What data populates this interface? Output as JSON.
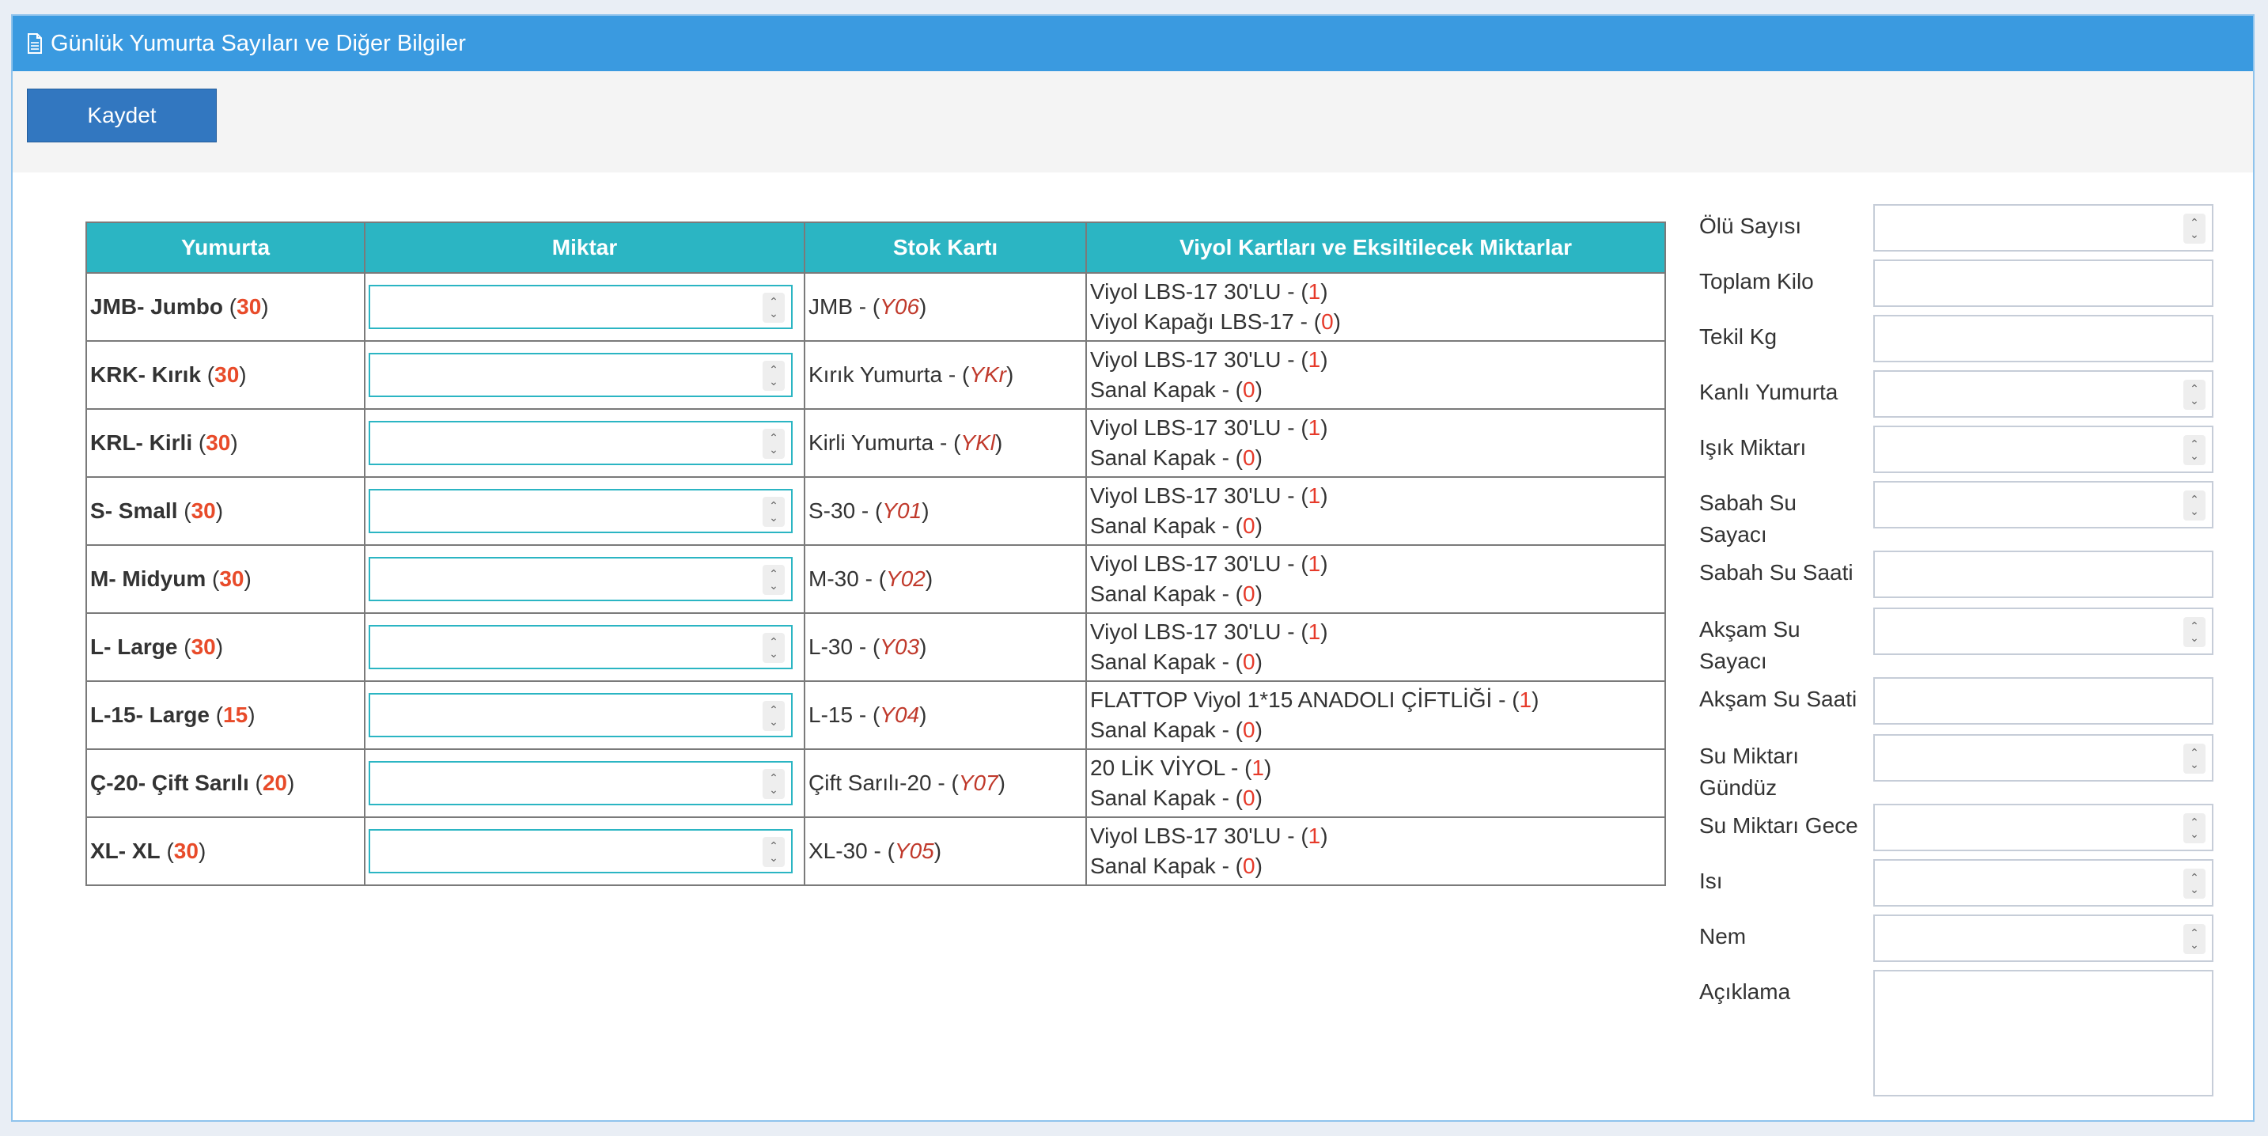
{
  "header": {
    "title": "Günlük Yumurta Sayıları ve Diğer Bilgiler",
    "icon": "document-icon"
  },
  "toolbar": {
    "save_label": "Kaydet"
  },
  "table": {
    "columns": [
      "Yumurta",
      "Miktar",
      "Stok Kartı",
      "Viyol Kartları ve Eksiltilecek Miktarlar"
    ],
    "rows": [
      {
        "code": "JMB",
        "name": "- Jumbo",
        "count": "30",
        "qty": "",
        "stock_name": "JMB - ",
        "stock_code": "Y06",
        "viyol": [
          {
            "name": "Viyol LBS-17 30'LU - ",
            "amount": "1"
          },
          {
            "name": "Viyol Kapağı LBS-17 - ",
            "amount": "0"
          }
        ]
      },
      {
        "code": "KRK",
        "name": "- Kırık",
        "count": "30",
        "qty": "",
        "stock_name": "Kırık Yumurta - ",
        "stock_code": "YKr",
        "viyol": [
          {
            "name": "Viyol LBS-17 30'LU - ",
            "amount": "1"
          },
          {
            "name": "Sanal Kapak - ",
            "amount": "0"
          }
        ]
      },
      {
        "code": "KRL",
        "name": "- Kirli",
        "count": "30",
        "qty": "",
        "stock_name": "Kirli Yumurta - ",
        "stock_code": "YKl",
        "viyol": [
          {
            "name": "Viyol LBS-17 30'LU - ",
            "amount": "1"
          },
          {
            "name": "Sanal Kapak - ",
            "amount": "0"
          }
        ]
      },
      {
        "code": "S",
        "name": "- Small",
        "count": "30",
        "qty": "",
        "stock_name": "S-30 - ",
        "stock_code": "Y01",
        "viyol": [
          {
            "name": "Viyol LBS-17 30'LU - ",
            "amount": "1"
          },
          {
            "name": "Sanal Kapak - ",
            "amount": "0"
          }
        ]
      },
      {
        "code": "M",
        "name": "- Midyum",
        "count": "30",
        "qty": "",
        "stock_name": "M-30 - ",
        "stock_code": "Y02",
        "viyol": [
          {
            "name": "Viyol LBS-17 30'LU - ",
            "amount": "1"
          },
          {
            "name": "Sanal Kapak - ",
            "amount": "0"
          }
        ]
      },
      {
        "code": "L",
        "name": "- Large",
        "count": "30",
        "qty": "",
        "stock_name": "L-30 - ",
        "stock_code": "Y03",
        "viyol": [
          {
            "name": "Viyol LBS-17 30'LU - ",
            "amount": "1"
          },
          {
            "name": "Sanal Kapak - ",
            "amount": "0"
          }
        ]
      },
      {
        "code": "L-15",
        "name": "- Large",
        "count": "15",
        "qty": "",
        "stock_name": "L-15 - ",
        "stock_code": "Y04",
        "viyol": [
          {
            "name": "FLATTOP Viyol 1*15 ANADOLI ÇİFTLİĞİ - ",
            "amount": "1"
          },
          {
            "name": "Sanal Kapak - ",
            "amount": "0"
          }
        ]
      },
      {
        "code": "Ç-20",
        "name": "- Çift Sarılı",
        "count": "20",
        "qty": "",
        "stock_name": "Çift Sarılı-20 - ",
        "stock_code": "Y07",
        "viyol": [
          {
            "name": "20 LİK VİYOL - ",
            "amount": "1"
          },
          {
            "name": "Sanal Kapak - ",
            "amount": "0"
          }
        ]
      },
      {
        "code": "XL",
        "name": "- XL",
        "count": "30",
        "qty": "",
        "stock_name": "XL-30 - ",
        "stock_code": "Y05",
        "viyol": [
          {
            "name": "Viyol LBS-17 30'LU - ",
            "amount": "1"
          },
          {
            "name": "Sanal Kapak - ",
            "amount": "0"
          }
        ]
      }
    ]
  },
  "side_form": {
    "fields": [
      {
        "key": "olu_sayisi",
        "label": "Ölü Sayısı",
        "type": "number",
        "value": ""
      },
      {
        "key": "toplam_kilo",
        "label": "Toplam Kilo",
        "type": "text",
        "value": ""
      },
      {
        "key": "tekil_kg",
        "label": "Tekil Kg",
        "type": "text",
        "value": ""
      },
      {
        "key": "kanli_yumurta",
        "label": "Kanlı Yumurta",
        "type": "number",
        "value": ""
      },
      {
        "key": "isik_miktari",
        "label": "Işık Miktarı",
        "type": "number",
        "value": ""
      },
      {
        "key": "sabah_su_sayaci",
        "label": "Sabah Su Sayacı",
        "type": "number",
        "value": ""
      },
      {
        "key": "sabah_su_saati",
        "label": "Sabah Su Saati",
        "type": "text",
        "value": ""
      },
      {
        "key": "aksam_su_sayaci",
        "label": "Akşam Su Sayacı",
        "type": "number",
        "value": ""
      },
      {
        "key": "aksam_su_saati",
        "label": "Akşam Su Saati",
        "type": "text",
        "value": ""
      },
      {
        "key": "su_miktari_gunduz",
        "label": "Su Miktarı Gündüz",
        "type": "number",
        "value": ""
      },
      {
        "key": "su_miktari_gece",
        "label": "Su Miktarı Gece",
        "type": "number",
        "value": ""
      },
      {
        "key": "isi",
        "label": "Isı",
        "type": "number",
        "value": ""
      },
      {
        "key": "nem",
        "label": "Nem",
        "type": "number",
        "value": ""
      },
      {
        "key": "aciklama",
        "label": "Açıklama",
        "type": "textarea",
        "value": ""
      }
    ]
  },
  "colors": {
    "header_bg": "#3a9ae0",
    "table_header_bg": "#2bb5c3",
    "button_bg": "#3277c0",
    "count_red": "#e84b2a"
  }
}
